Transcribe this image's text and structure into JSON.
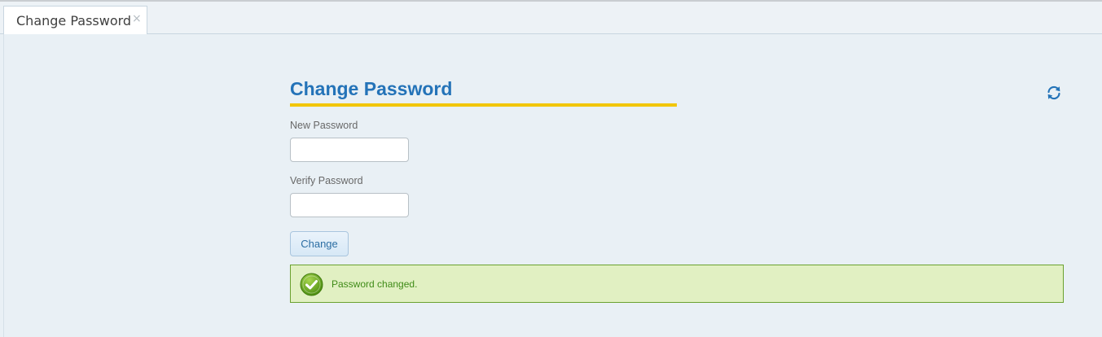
{
  "tabs": [
    {
      "label": "Change Password",
      "close_glyph": "×",
      "active": true
    }
  ],
  "header": {
    "refresh_icon": "refresh-icon"
  },
  "form": {
    "title": "Change Password",
    "new_password": {
      "label": "New Password",
      "value": "",
      "placeholder": ""
    },
    "verify_password": {
      "label": "Verify Password",
      "value": "",
      "placeholder": ""
    },
    "submit_label": "Change"
  },
  "alert": {
    "type": "success",
    "icon": "check-circle-icon",
    "message": "Password changed."
  },
  "colors": {
    "title": "#2473b8",
    "underline": "#f2c600",
    "success_bg": "#e1f0c2",
    "success_border": "#6aa12f",
    "success_text": "#3f8b17",
    "background": "#e9f0f5"
  }
}
